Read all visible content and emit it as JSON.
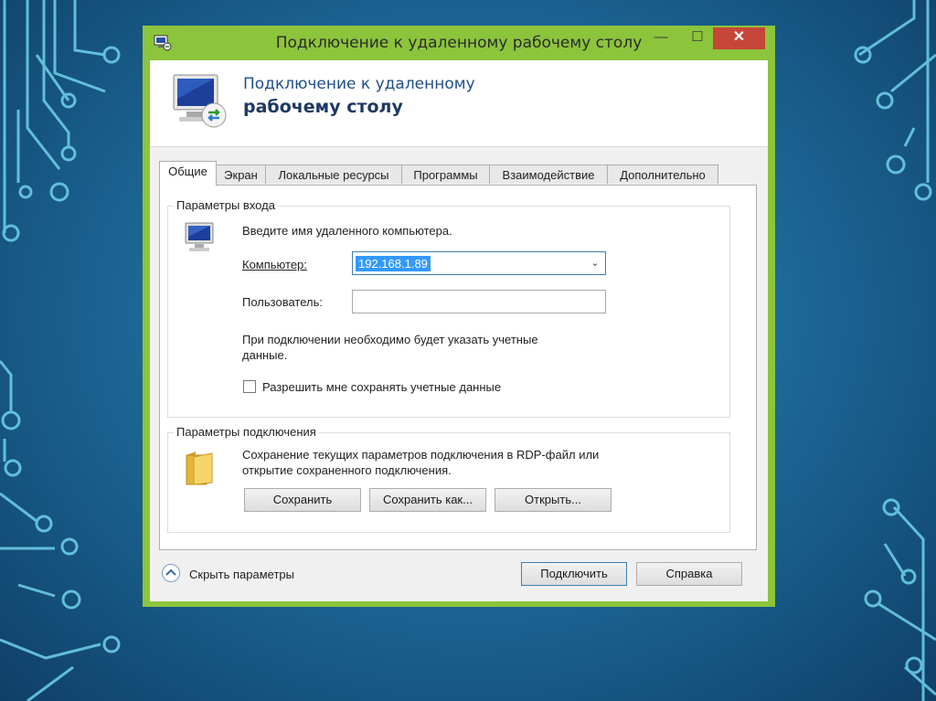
{
  "window": {
    "title": "Подключение к удаленному рабочему столу",
    "min_glyph": "—",
    "max_glyph": "☐",
    "close_glyph": "✕"
  },
  "banner": {
    "line1": "Подключение к удаленному",
    "line2": "рабочему столу"
  },
  "tabs": [
    "Общие",
    "Экран",
    "Локальные ресурсы",
    "Программы",
    "Взаимодействие",
    "Дополнительно"
  ],
  "login_group": {
    "title": "Параметры входа",
    "prompt": "Введите имя удаленного компьютера.",
    "computer_label": "Компьютер:",
    "computer_value": "192.168.1.89",
    "user_label": "Пользователь:",
    "user_value": "",
    "note_line1": "При подключении необходимо будет указать учетные",
    "note_line2": "данные.",
    "remember_label": "Разрешить мне сохранять учетные данные",
    "remember_checked": false
  },
  "connection_group": {
    "title": "Параметры подключения",
    "desc_line1": "Сохранение текущих параметров подключения в RDP-файл или",
    "desc_line2": "открытие сохраненного подключения.",
    "save_label": "Сохранить",
    "save_as_label": "Сохранить как...",
    "open_label": "Открыть..."
  },
  "footer": {
    "hide_label": "Скрыть параметры",
    "connect_label": "Подключить",
    "help_label": "Справка"
  },
  "colors": {
    "window_frame": "#8cc43c",
    "close_button": "#c7463a",
    "selection": "#3399ff",
    "banner_title": "#1f4e8c"
  }
}
